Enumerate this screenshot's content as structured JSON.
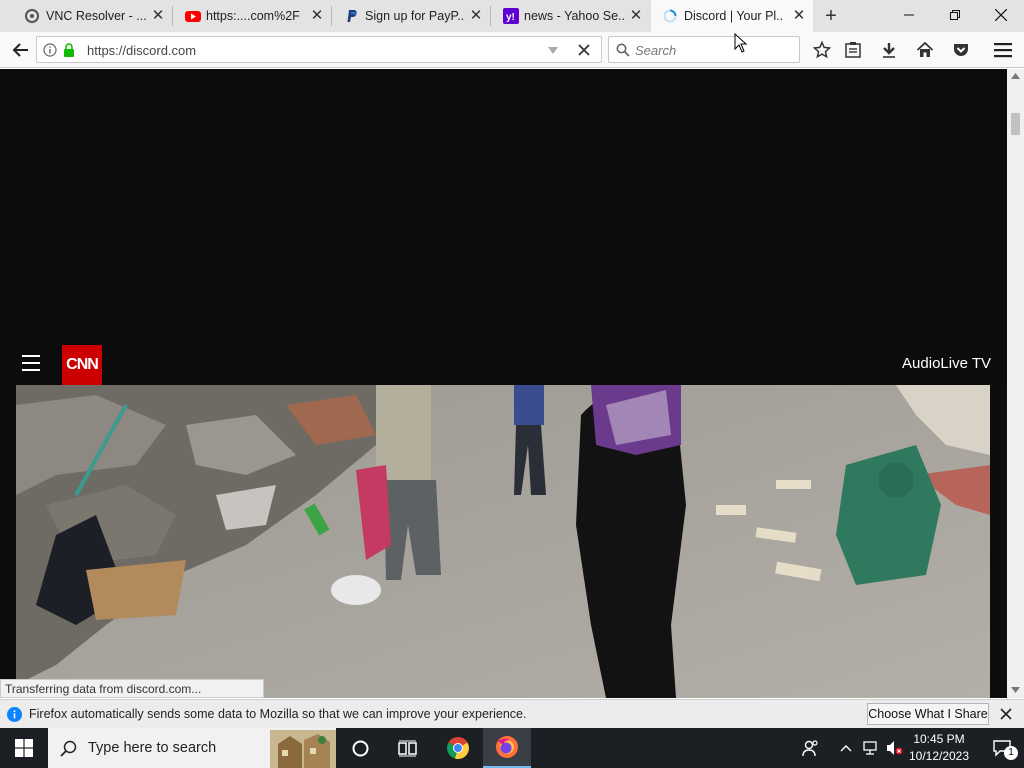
{
  "tabs": [
    {
      "label": "VNC Resolver - ...",
      "icon": "vnc-icon",
      "active": false
    },
    {
      "label": "https:....com%2F",
      "icon": "youtube-icon",
      "active": false
    },
    {
      "label": "Sign up for PayP...",
      "icon": "paypal-icon",
      "active": false
    },
    {
      "label": "news - Yahoo Se...",
      "icon": "yahoo-icon",
      "active": false
    },
    {
      "label": "Discord | Your Pl...",
      "icon": "loading-spinner-icon",
      "active": true
    }
  ],
  "navbar": {
    "url": "https://discord.com",
    "search_placeholder": "Search"
  },
  "page": {
    "brand": "CNN",
    "audiolive": "AudioLive TV"
  },
  "status": {
    "transfer": "Transferring data from discord.com..."
  },
  "notification": {
    "text": "Firefox automatically sends some data to Mozilla so that we can improve your experience.",
    "button": "Choose What I Share"
  },
  "taskbar": {
    "search_placeholder": "Type here to search",
    "time": "10:45 PM",
    "date": "10/12/2023",
    "notification_count": "1"
  },
  "colors": {
    "cnn_red": "#cc0000",
    "tab_strip": "#e3e3e3",
    "taskbar": "#1c1f24"
  }
}
